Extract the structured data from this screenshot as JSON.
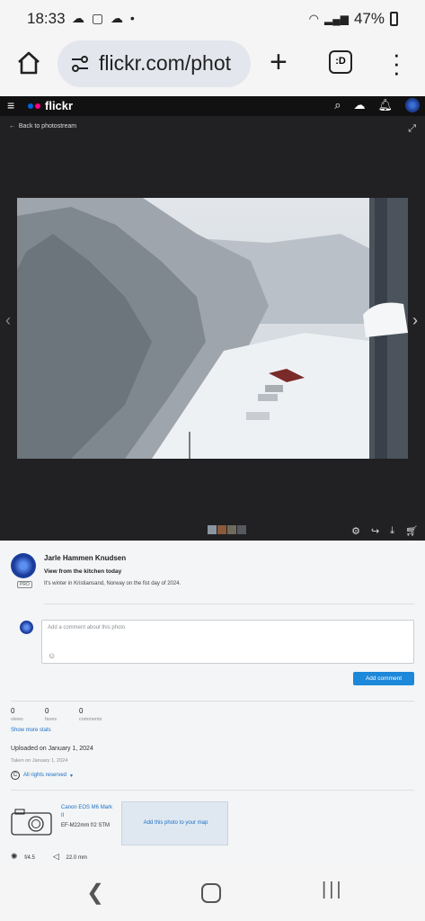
{
  "status": {
    "time": "18:33",
    "battery": "47%"
  },
  "browser": {
    "url": "flickr.com/phot",
    "tab_label": ":D"
  },
  "flickr": {
    "logo": "flickr"
  },
  "viewer": {
    "back_label": "Back to photostream"
  },
  "photo_info": {
    "author": "Jarle Hammen Knudsen",
    "pro_badge": "PRO",
    "title": "View from the kitchen today",
    "description": "It's winter in Kristiansand, Norway on the fist day of 2024."
  },
  "comment": {
    "placeholder": "Add a comment about this photo",
    "button": "Add comment"
  },
  "stats": [
    {
      "value": "0",
      "label": "views"
    },
    {
      "value": "0",
      "label": "faves"
    },
    {
      "value": "0",
      "label": "comments"
    }
  ],
  "show_more_stats": "Show more stats",
  "uploaded": "Uploaded on January 1, 2024",
  "taken": "Taken on January 1, 2024",
  "rights": "All rights reserved",
  "camera": {
    "name": "Canon EOS M6 Mark II",
    "lens": "EF-M22mm f/2 STM"
  },
  "map_label": "Add this photo to your map",
  "exif": {
    "aperture": "f/4.5",
    "focal_length": "22.0 mm"
  },
  "colors": {
    "accent": "#1c88d9",
    "flickr_pink": "#ff0084",
    "flickr_blue": "#0063dc"
  }
}
